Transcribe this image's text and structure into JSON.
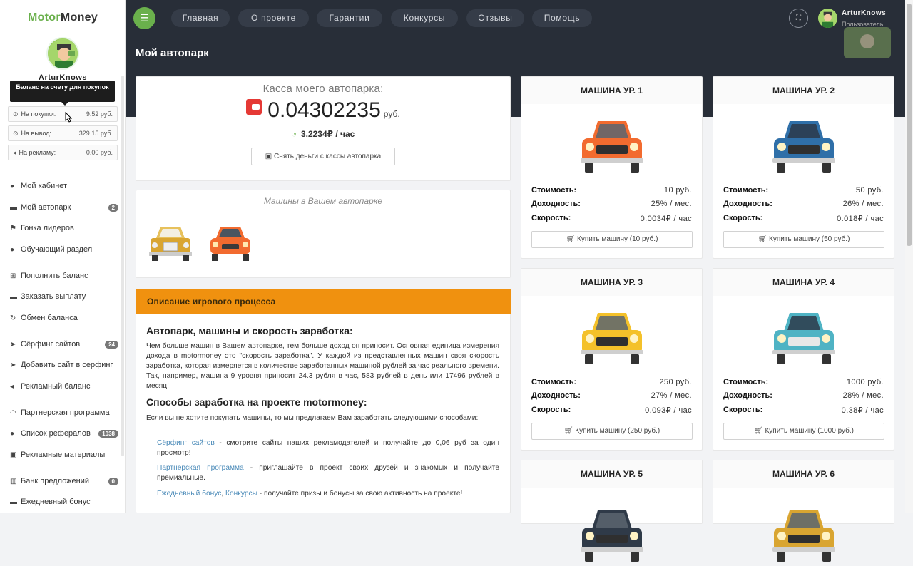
{
  "brand": {
    "part1": "Motor",
    "part2": "Money"
  },
  "user": {
    "name": "ArturKnows",
    "role": "Пользователь",
    "tooltip": "Баланс на счету для покупок"
  },
  "balances": [
    {
      "icon": "⊙",
      "label": "На покупки:",
      "value": "9.52 руб."
    },
    {
      "icon": "⊙",
      "label": "На вывод:",
      "value": "329.15 руб."
    },
    {
      "icon": "◂",
      "label": "На рекламу:",
      "value": "0.00 руб."
    }
  ],
  "menu": [
    {
      "icon": "●",
      "label": "Мой кабинет",
      "badge": ""
    },
    {
      "icon": "▬",
      "label": "Мой автопарк",
      "badge": "2"
    },
    {
      "icon": "⚑",
      "label": "Гонка лидеров",
      "badge": ""
    },
    {
      "icon": "●",
      "label": "Обучающий раздел",
      "badge": ""
    },
    {
      "icon": "⊞",
      "label": "Пополнить баланс",
      "badge": ""
    },
    {
      "icon": "▬",
      "label": "Заказать выплату",
      "badge": ""
    },
    {
      "icon": "↻",
      "label": "Обмен баланса",
      "badge": ""
    },
    {
      "icon": "➤",
      "label": "Сёрфинг сайтов",
      "badge": "24"
    },
    {
      "icon": "➤",
      "label": "Добавить сайт в серфинг",
      "badge": ""
    },
    {
      "icon": "◂",
      "label": "Рекламный баланс",
      "badge": ""
    },
    {
      "icon": "◠",
      "label": "Партнерская программа",
      "badge": ""
    },
    {
      "icon": "●",
      "label": "Список рефералов",
      "badge": "1038"
    },
    {
      "icon": "▣",
      "label": "Рекламные материалы",
      "badge": ""
    },
    {
      "icon": "▥",
      "label": "Банк предложений",
      "badge": "0"
    },
    {
      "icon": "▬",
      "label": "Ежедневный бонус",
      "badge": ""
    }
  ],
  "nav": [
    "Главная",
    "О проекте",
    "Гарантии",
    "Конкурсы",
    "Отзывы",
    "Помощь"
  ],
  "page_title": "Мой автопарк",
  "kassa": {
    "title": "Касса моего автопарка:",
    "value": "0.04302235",
    "currency": "руб.",
    "rate": "3.2234₽ / час",
    "withdraw": "Снять деньги с кассы автопарка"
  },
  "owned": {
    "title": "Машины в Вашем автопарке"
  },
  "desc": {
    "header": "Описание игрового процесса",
    "h1": "Автопарк, машины и скорость заработка:",
    "p1": "Чем больше машин в Вашем автопарке, тем больше доход он приносит. Основная единица измерения дохода в motormoney это \"скорость заработка\". У каждой из представленных машин своя скорость заработка, которая измеряется в количестве заработанных машиной рублей за час реального времени. Так, например, машина 9 уровня приносит 24.3 рубля в час, 583 рублей в день или 17496 рублей в месяц!",
    "h2": "Способы заработка на проекте motormoney:",
    "p2": "Если вы не хотите покупать машины, то мы предлагаем Вам заработать следующими способами:",
    "l1a": "Сёрфинг сайтов",
    "l1b": " - смотрите сайты наших рекламодателей и получайте до 0,06 руб за один просмотр!",
    "l2a": "Партнерская программа",
    "l2b": " - приглашайте в проект своих друзей и знакомых и получайте премиальные.",
    "l3a": "Ежедневный бонус",
    "l3sep": ", ",
    "l3c": "Конкурсы",
    "l3b": " - получайте призы и бонусы за свою активность на проекте!"
  },
  "stat_labels": {
    "cost": "Стоимость:",
    "yield": "Доходность:",
    "speed": "Скорость:"
  },
  "cars": [
    {
      "title": "МАШИНА УР. 1",
      "cost": "10 руб.",
      "yield": "25% / мес.",
      "speed": "0.0034₽ / час",
      "buy": "Купить машину (10 руб.)",
      "color": "#f26b2f"
    },
    {
      "title": "МАШИНА УР. 2",
      "cost": "50 руб.",
      "yield": "26% / мес.",
      "speed": "0.018₽ / час",
      "buy": "Купить машину (50 руб.)",
      "color": "#2f6fa8"
    },
    {
      "title": "МАШИНА УР. 3",
      "cost": "250 руб.",
      "yield": "27% / мес.",
      "speed": "0.093₽ / час",
      "buy": "Купить машину (250 руб.)",
      "color": "#f4c12a"
    },
    {
      "title": "МАШИНА УР. 4",
      "cost": "1000 руб.",
      "yield": "28% / мес.",
      "speed": "0.38₽ / час",
      "buy": "Купить машину (1000 руб.)",
      "color": "#4fb3c4"
    },
    {
      "title": "МАШИНА УР. 5",
      "color": "#2f3a48"
    },
    {
      "title": "МАШИНА УР. 6",
      "color": "#d9a531"
    }
  ],
  "colors": {
    "accent": "#6ab04c",
    "topbar": "#282e38",
    "orange": "#f0910f",
    "link": "#4a8ab8"
  }
}
